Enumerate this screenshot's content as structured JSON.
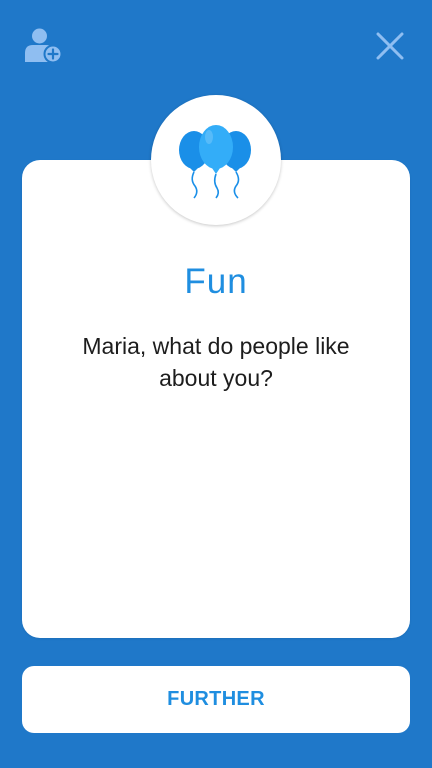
{
  "colors": {
    "background": "#1f78c9",
    "accent": "#1f8ee0",
    "icon_muted": "#8fbef1",
    "card": "#ffffff",
    "text": "#1d1d1d"
  },
  "header": {
    "left_icon": "add-user-icon",
    "right_icon": "close-icon"
  },
  "card": {
    "icon": "balloons-icon",
    "category": "Fun",
    "question": "Maria, what do people like about you?"
  },
  "actions": {
    "further_label": "FURTHER"
  }
}
